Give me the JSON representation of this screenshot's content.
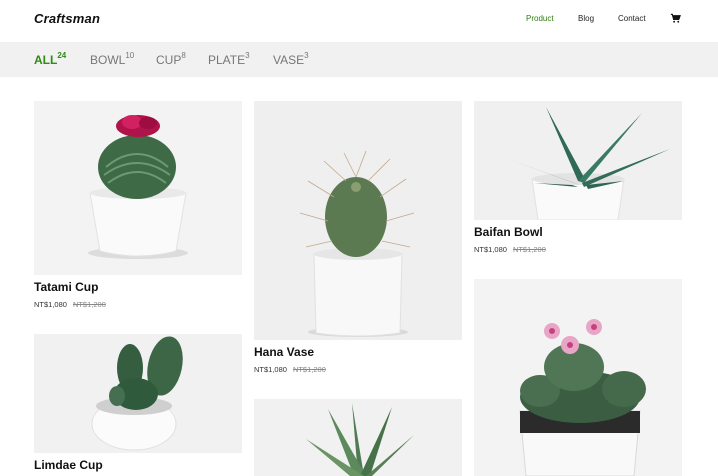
{
  "brand": "Craftsman",
  "nav": {
    "product": "Product",
    "blog": "Blog",
    "contact": "Contact",
    "cart_icon": "cart-icon"
  },
  "filters": [
    {
      "label": "ALL",
      "count": "24",
      "active": true
    },
    {
      "label": "BOWL",
      "count": "10"
    },
    {
      "label": "CUP",
      "count": "8"
    },
    {
      "label": "PLATE",
      "count": "3"
    },
    {
      "label": "VASE",
      "count": "3"
    }
  ],
  "products": [
    {
      "name": "Tatami Cup",
      "price": "NT$1,080",
      "old_price": "NT$1,200"
    },
    {
      "name": "Hana Vase",
      "price": "NT$1,080",
      "old_price": "NT$1,200"
    },
    {
      "name": "Baifan Bowl",
      "price": "NT$1,080",
      "old_price": "NT$1,200"
    },
    {
      "name": "Limdae Cup"
    }
  ],
  "colors": {
    "accent": "#2e8b13",
    "filterbar": "#f1f1f1"
  }
}
